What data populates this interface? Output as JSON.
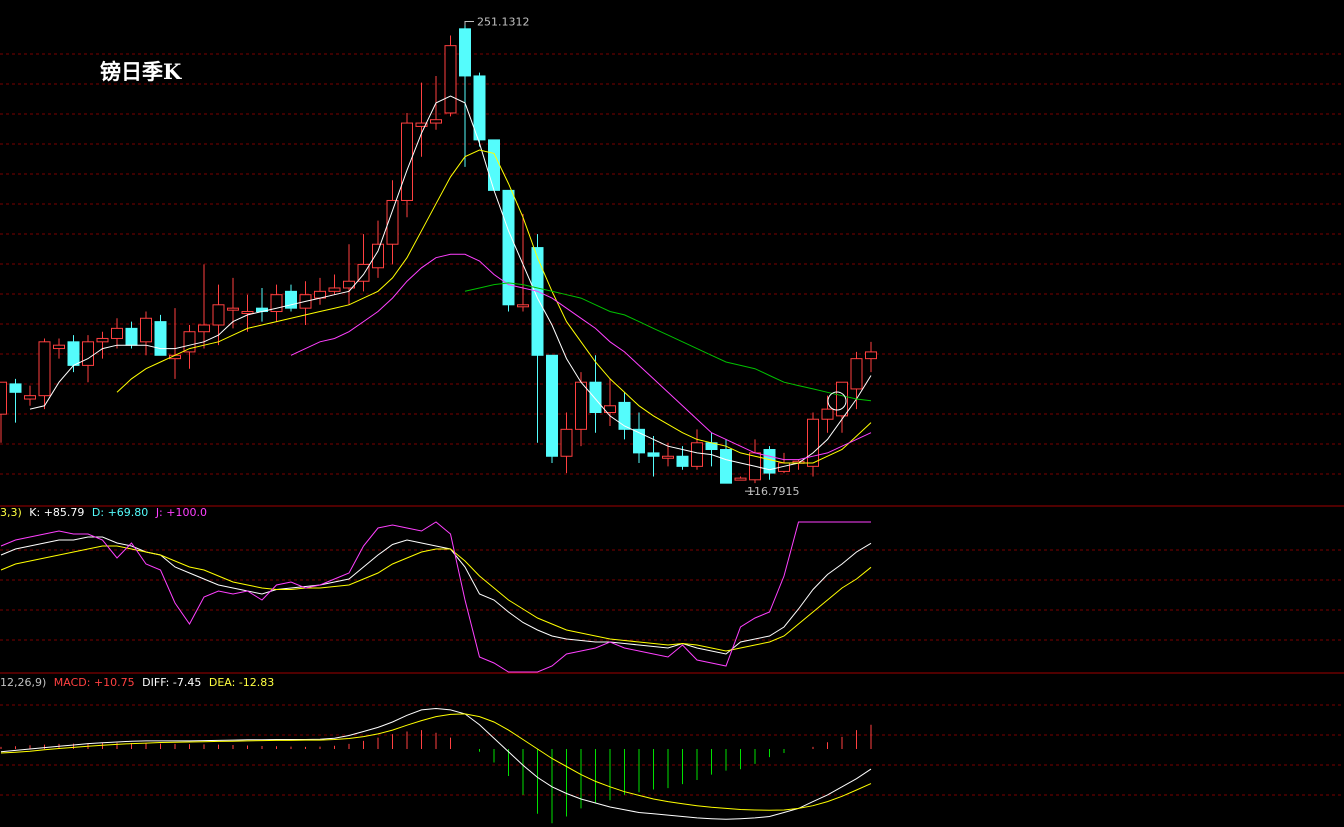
{
  "title": "镑日季K",
  "price_panel": {
    "high_label": "251.1312",
    "low_label": "116.7915"
  },
  "kdj_header": {
    "params": "3,3)",
    "k_label": "K: +85.79",
    "d_label": "D: +69.80",
    "j_label": "J: +100.0"
  },
  "macd_header": {
    "params": "12,26,9)",
    "macd_label": "MACD: +10.75",
    "diff_label": "DIFF: -7.45",
    "dea_label": "DEA: -12.83"
  },
  "colors": {
    "up": "#ff4040",
    "down": "#54fcfc",
    "ma5": "#ffffff",
    "ma10": "#ffff00",
    "ma20": "#ff40ff",
    "ma30": "#00c000",
    "k": "#ffffff",
    "d": "#ffff00",
    "j": "#ff40ff",
    "grid": "#7a0000",
    "separator": "#a00000",
    "neg_bar": "#00e000"
  },
  "chart_data": [
    {
      "type": "candlestick",
      "title": "镑日季K",
      "ylim": [
        110,
        255
      ],
      "series": [
        {
          "name": "price",
          "ohlc": [
            [
              135.5,
              145.0,
              127.0,
              145.0
            ],
            [
              144.5,
              146.0,
              133.0,
              142.0
            ],
            [
              140.0,
              144.0,
              138.0,
              141.0
            ],
            [
              141.0,
              158.0,
              137.0,
              157.0
            ],
            [
              155.0,
              158.0,
              152.0,
              156.0
            ],
            [
              157.0,
              159.0,
              148.0,
              150.0
            ],
            [
              150.0,
              159.0,
              145.0,
              157.0
            ],
            [
              157.0,
              160.0,
              152.0,
              158.0
            ],
            [
              158.0,
              164.0,
              155.0,
              161.0
            ],
            [
              161.0,
              163.0,
              155.0,
              156.0
            ],
            [
              157.0,
              166.0,
              153.0,
              164.0
            ],
            [
              163.0,
              165.0,
              156.0,
              153.0
            ],
            [
              152.0,
              167.0,
              146.0,
              153.0
            ],
            [
              154.0,
              162.0,
              149.0,
              160.0
            ],
            [
              160.0,
              180.0,
              155.0,
              162.0
            ],
            [
              162.0,
              174.0,
              156.0,
              168.0
            ],
            [
              167.0,
              176.0,
              161.0,
              167.0
            ],
            [
              166.0,
              171.0,
              160.0,
              166.0
            ],
            [
              167.0,
              173.0,
              163.0,
              166.0
            ],
            [
              166.0,
              174.0,
              163.0,
              171.0
            ],
            [
              172.0,
              174.0,
              166.0,
              167.0
            ],
            [
              167.0,
              175.0,
              162.0,
              171.0
            ],
            [
              170.0,
              176.0,
              168.0,
              172.0
            ],
            [
              172.0,
              177.0,
              171.0,
              173.0
            ],
            [
              173.0,
              186.0,
              168.0,
              175.0
            ],
            [
              175.0,
              189.0,
              172.0,
              180.0
            ],
            [
              179.0,
              193.0,
              176.0,
              186.0
            ],
            [
              186.0,
              205.0,
              180.0,
              199.0
            ],
            [
              199.0,
              225.0,
              194.0,
              222.0
            ],
            [
              221.0,
              234.0,
              212.0,
              222.0
            ],
            [
              222.0,
              236.0,
              220.0,
              223.0
            ],
            [
              225.0,
              248.0,
              224.0,
              245.0
            ],
            [
              250.0,
              251.0,
              209.0,
              236.0
            ],
            [
              236.0,
              237.0,
              215.0,
              217.0
            ],
            [
              217.0,
              210.0,
              211.0,
              202.0
            ],
            [
              202.0,
              190.0,
              166.0,
              168.0
            ],
            [
              168.0,
              195.0,
              166.0,
              168.0
            ],
            [
              185.0,
              189.0,
              127.0,
              153.0
            ],
            [
              153.0,
              153.0,
              121.0,
              123.0
            ],
            [
              123.0,
              136.0,
              118.0,
              131.0
            ],
            [
              131.0,
              148.0,
              126.0,
              145.0
            ],
            [
              145.0,
              153.0,
              130.0,
              136.0
            ],
            [
              136.0,
              146.0,
              132.0,
              138.0
            ],
            [
              139.0,
              142.0,
              128.0,
              131.0
            ],
            [
              131.0,
              136.0,
              121.0,
              124.0
            ],
            [
              124.0,
              129.0,
              117.0,
              123.0
            ],
            [
              123.0,
              127.0,
              120.0,
              123.0
            ],
            [
              123.0,
              126.0,
              119.0,
              120.0
            ],
            [
              120.0,
              131.0,
              119.0,
              127.0
            ],
            [
              127.0,
              130.0,
              120.0,
              125.0
            ],
            [
              125.0,
              128.0,
              116.8,
              115.0
            ],
            [
              116.0,
              117.0,
              116.5,
              116.5
            ],
            [
              116.0,
              128.0,
              115.0,
              124.0
            ],
            [
              125.0,
              126.0,
              116.0,
              118.0
            ],
            [
              118.5,
              124.0,
              118.0,
              121.0
            ],
            [
              121.0,
              122.0,
              119.0,
              121.5
            ],
            [
              120.0,
              136.0,
              117.0,
              134.0
            ],
            [
              134.0,
              141.0,
              130.0,
              137.0
            ],
            [
              135.0,
              145.0,
              130.0,
              145.0
            ],
            [
              143.0,
              154.0,
              137.0,
              152.0
            ],
            [
              152.0,
              157.0,
              148.0,
              154.0
            ]
          ]
        },
        {
          "name": "MA5",
          "values": [
            null,
            null,
            137.0,
            138.0,
            145.0,
            150.0,
            152.0,
            155.0,
            156.0,
            156.0,
            156.0,
            155.0,
            155.0,
            156.0,
            157.0,
            159.0,
            163.0,
            165.0,
            166.0,
            167.0,
            168.0,
            169.0,
            170.0,
            171.0,
            172.0,
            177.0,
            184.0,
            196.0,
            208.0,
            219.0,
            228.0,
            230.0,
            228.0,
            216.0,
            202.0,
            190.0,
            180.0,
            170.0,
            162.0,
            152.0,
            145.0,
            140.0,
            135.0,
            132.0,
            130.0,
            128.0,
            126.0,
            125.0,
            124.0,
            123.5,
            122.0,
            121.0,
            120.0,
            119.0,
            120.0,
            121.0,
            124.0,
            128.0,
            134.0,
            140.0,
            147.0
          ]
        },
        {
          "name": "MA10",
          "values": [
            null,
            null,
            null,
            null,
            null,
            null,
            null,
            null,
            142.0,
            146.0,
            149.0,
            151.0,
            153.0,
            155.0,
            156.0,
            157.0,
            159.0,
            161.0,
            162.0,
            163.0,
            164.0,
            165.0,
            166.0,
            167.0,
            168.0,
            170.0,
            172.0,
            176.0,
            182.0,
            190.0,
            198.0,
            206.0,
            212.0,
            214.0,
            213.0,
            204.0,
            194.0,
            182.0,
            172.0,
            163.0,
            157.0,
            151.0,
            146.0,
            142.0,
            138.0,
            135.0,
            132.5,
            130.0,
            128.0,
            127.0,
            126.0,
            124.0,
            123.0,
            122.0,
            121.0,
            121.0,
            121.0,
            123.0,
            125.0,
            129.0,
            133.0
          ]
        },
        {
          "name": "MA20",
          "values": [
            null,
            null,
            null,
            null,
            null,
            null,
            null,
            null,
            null,
            null,
            null,
            null,
            null,
            null,
            null,
            null,
            null,
            null,
            null,
            null,
            153.0,
            155.0,
            157.0,
            158.0,
            160.0,
            163.0,
            166.0,
            170.0,
            175.0,
            179.0,
            182.0,
            183.0,
            183.0,
            181.0,
            177.0,
            174.0,
            173.0,
            172.0,
            170.0,
            167.0,
            164.0,
            161.0,
            157.0,
            154.0,
            150.0,
            146.0,
            142.0,
            138.0,
            134.0,
            130.0,
            128.0,
            126.0,
            124.0,
            123.0,
            122.0,
            122.0,
            123.0,
            124.0,
            126.0,
            128.0,
            130.0
          ]
        },
        {
          "name": "MA30",
          "values": [
            null,
            null,
            null,
            null,
            null,
            null,
            null,
            null,
            null,
            null,
            null,
            null,
            null,
            null,
            null,
            null,
            null,
            null,
            null,
            null,
            null,
            null,
            null,
            null,
            null,
            null,
            null,
            null,
            null,
            null,
            null,
            null,
            172.0,
            173.0,
            174.0,
            174.5,
            174.0,
            173.0,
            172.0,
            171.0,
            170.0,
            168.0,
            166.0,
            165.0,
            163.0,
            161.0,
            159.0,
            157.0,
            155.0,
            153.0,
            151.0,
            150.0,
            149.0,
            147.0,
            145.0,
            144.0,
            143.0,
            142.0,
            141.0,
            140.0,
            139.5
          ]
        }
      ]
    },
    {
      "type": "line",
      "title": "KDJ",
      "ylim": [
        0,
        100
      ],
      "series": [
        {
          "name": "K",
          "values": [
            78,
            82,
            84,
            86,
            88,
            88,
            90,
            90,
            86,
            84,
            80,
            78,
            70,
            66,
            62,
            58,
            56,
            54,
            52,
            55,
            56,
            57,
            58,
            60,
            62,
            70,
            78,
            85,
            88,
            86,
            84,
            82,
            70,
            52,
            48,
            40,
            33,
            28,
            24,
            22,
            21,
            20,
            20,
            19,
            18,
            17,
            16,
            19,
            16,
            14,
            12,
            20,
            22,
            24,
            30,
            42,
            55,
            65,
            72,
            80,
            85.79
          ]
        },
        {
          "name": "D",
          "values": [
            68,
            72,
            74,
            76,
            78,
            80,
            82,
            84,
            84,
            82,
            80,
            78,
            74,
            70,
            68,
            64,
            60,
            58,
            56,
            55,
            55,
            56,
            56,
            57,
            58,
            62,
            66,
            72,
            76,
            80,
            82,
            82,
            74,
            64,
            56,
            48,
            42,
            36,
            32,
            28,
            26,
            24,
            22,
            21,
            20,
            19,
            18,
            19,
            18,
            16,
            14,
            16,
            18,
            20,
            24,
            32,
            40,
            48,
            56,
            62,
            69.8
          ]
        },
        {
          "name": "J",
          "values": [
            84,
            88,
            90,
            92,
            94,
            92,
            92,
            88,
            76,
            86,
            72,
            68,
            46,
            32,
            50,
            54,
            52,
            54,
            48,
            58,
            60,
            56,
            58,
            62,
            66,
            84,
            96,
            98,
            96,
            94,
            100,
            92,
            48,
            10,
            6,
            0,
            0,
            0,
            4,
            12,
            14,
            16,
            20,
            16,
            14,
            12,
            10,
            18,
            8,
            6,
            4,
            30,
            36,
            40,
            64,
            100,
            100,
            100,
            100,
            100,
            100.0
          ]
        }
      ]
    },
    {
      "type": "bar",
      "title": "MACD",
      "ylim": [
        -28,
        18
      ],
      "series": [
        {
          "name": "MACD",
          "values": [
            0.8,
            1.0,
            1.4,
            1.6,
            1.9,
            2.0,
            2.1,
            2.2,
            2.3,
            2.2,
            2.1,
            2.0,
            1.9,
            1.8,
            1.7,
            1.6,
            1.5,
            1.3,
            1.1,
            1.0,
            0.9,
            0.8,
            0.9,
            1.2,
            1.9,
            3.0,
            4.2,
            5.5,
            6.5,
            7.0,
            6.0,
            4.2,
            0.0,
            -1.0,
            -5.0,
            -10.0,
            -17.0,
            -24.0,
            -27.5,
            -25.0,
            -22.0,
            -20.0,
            -19.0,
            -17.0,
            -16.0,
            -15.0,
            -14.5,
            -13.0,
            -11.5,
            -9.5,
            -8.0,
            -7.5,
            -5.5,
            -3.0,
            -1.5,
            0.0,
            0.8,
            2.5,
            4.5,
            7.0,
            9.0,
            10.75
          ]
        },
        {
          "name": "DIFF",
          "values": [
            -1.0,
            -0.5,
            0.0,
            0.5,
            1.0,
            1.5,
            2.0,
            2.3,
            2.6,
            2.9,
            3.0,
            3.0,
            3.0,
            3.0,
            3.1,
            3.2,
            3.3,
            3.4,
            3.4,
            3.5,
            3.5,
            3.5,
            3.6,
            4.0,
            5.0,
            6.5,
            8.0,
            10.0,
            12.5,
            14.5,
            15.0,
            14.5,
            13.0,
            9.0,
            4.0,
            -1.0,
            -6.0,
            -10.5,
            -14.0,
            -16.5,
            -18.5,
            -20.0,
            -21.5,
            -22.5,
            -23.5,
            -24.0,
            -24.5,
            -25.0,
            -25.5,
            -25.8,
            -26.0,
            -25.8,
            -25.5,
            -25.0,
            -23.5,
            -22.0,
            -19.5,
            -17.0,
            -14.0,
            -11.0,
            -7.45
          ]
        },
        {
          "name": "DEA",
          "values": [
            -1.5,
            -1.2,
            -0.8,
            -0.3,
            0.2,
            0.6,
            1.0,
            1.4,
            1.7,
            2.0,
            2.2,
            2.4,
            2.5,
            2.6,
            2.7,
            2.8,
            2.9,
            3.0,
            3.1,
            3.2,
            3.2,
            3.3,
            3.3,
            3.5,
            3.9,
            4.6,
            5.6,
            7.0,
            8.8,
            10.5,
            12.0,
            12.8,
            13.0,
            12.0,
            10.0,
            7.0,
            3.5,
            0.0,
            -3.5,
            -6.5,
            -9.5,
            -12.0,
            -14.0,
            -15.8,
            -17.2,
            -18.5,
            -19.5,
            -20.3,
            -21.0,
            -21.6,
            -22.0,
            -22.4,
            -22.6,
            -22.7,
            -22.6,
            -22.0,
            -21.0,
            -19.5,
            -17.5,
            -15.2,
            -12.83
          ]
        }
      ]
    }
  ]
}
